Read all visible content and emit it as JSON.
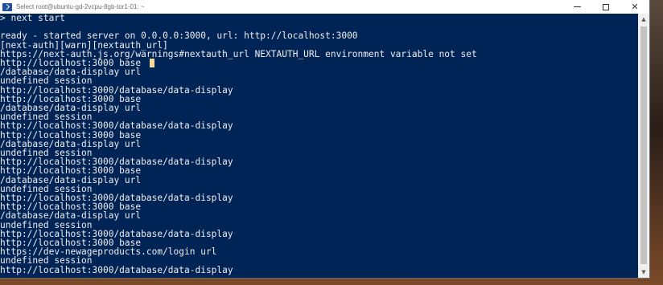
{
  "window": {
    "title": "Select root@ubuntu-gd-2vcpu-8gb-tor1-01: ~"
  },
  "controls": {
    "minimize_icon": "minimize-icon",
    "maximize_icon": "maximize-icon",
    "close_glyph": "✕"
  },
  "console": {
    "lines": [
      "> next start",
      "",
      "ready - started server on 0.0.0.0:3000, url: http://localhost:3000",
      "[next-auth][warn][nextauth_url]",
      "https://next-auth.js.org/warnings#nextauth_url NEXTAUTH_URL environment variable not set",
      "http://localhost:3000 base",
      "/database/data-display url",
      "undefined session",
      "http://localhost:3000/database/data-display",
      "http://localhost:3000 base",
      "/database/data-display url",
      "undefined session",
      "http://localhost:3000/database/data-display",
      "http://localhost:3000 base",
      "/database/data-display url",
      "undefined session",
      "http://localhost:3000/database/data-display",
      "http://localhost:3000 base",
      "/database/data-display url",
      "undefined session",
      "http://localhost:3000/database/data-display",
      "http://localhost:3000 base",
      "/database/data-display url",
      "undefined session",
      "http://localhost:3000/database/data-display",
      "http://localhost:3000 base",
      "https://dev-newageproducts.com/login url",
      "undefined session",
      "http://localhost:3000/database/data-display"
    ]
  },
  "colors": {
    "console_background": "#012456",
    "console_text": "#eeeeee",
    "cursor": "#f5d8a0",
    "titlebar": "#ffffff"
  }
}
